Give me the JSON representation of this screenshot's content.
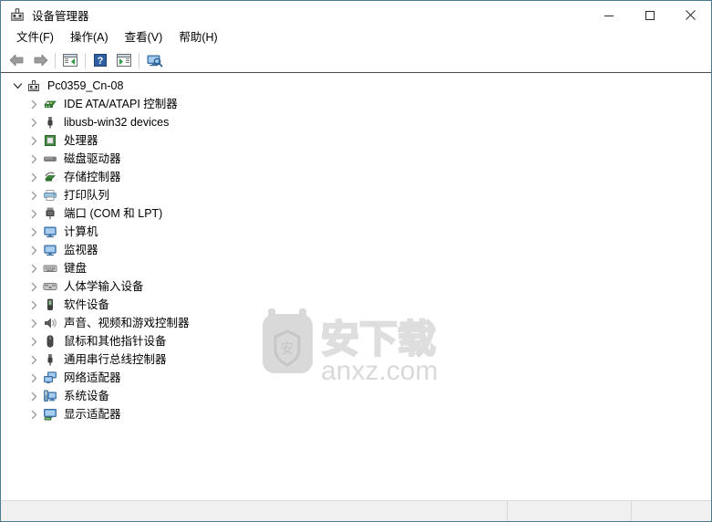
{
  "window": {
    "title": "设备管理器",
    "icon": "device-manager-icon",
    "controls": {
      "minimize": "最小化",
      "maximize": "最大化",
      "close": "关闭"
    },
    "border_color": "#4a7a8c"
  },
  "menubar": {
    "items": [
      {
        "label": "文件(F)",
        "name": "menu-file"
      },
      {
        "label": "操作(A)",
        "name": "menu-action"
      },
      {
        "label": "查看(V)",
        "name": "menu-view"
      },
      {
        "label": "帮助(H)",
        "name": "menu-help"
      }
    ]
  },
  "toolbar": {
    "items": [
      {
        "name": "back-button",
        "icon": "arrow-left-icon",
        "label": "后退"
      },
      {
        "name": "forward-button",
        "icon": "arrow-right-icon",
        "label": "前进"
      },
      {
        "name": "toolbar-separator-1",
        "icon": "separator",
        "label": ""
      },
      {
        "name": "show-hide-console-tree-button",
        "icon": "console-tree-icon",
        "label": "显示/隐藏控制台树"
      },
      {
        "name": "toolbar-separator-2",
        "icon": "separator",
        "label": ""
      },
      {
        "name": "help-button",
        "icon": "help-question-icon",
        "label": "帮助"
      },
      {
        "name": "properties-button",
        "icon": "properties-icon",
        "label": "属性"
      },
      {
        "name": "toolbar-separator-3",
        "icon": "separator",
        "label": ""
      },
      {
        "name": "scan-hardware-changes-button",
        "icon": "scan-monitor-icon",
        "label": "扫描检测硬件改动"
      }
    ]
  },
  "tree": {
    "root": {
      "label": "Pc0359_Cn-08",
      "icon": "computer-icon",
      "expanded": true
    },
    "children": [
      {
        "label": "IDE ATA/ATAPI 控制器",
        "icon": "ide-controller-icon"
      },
      {
        "label": "libusb-win32 devices",
        "icon": "usb-plug-icon"
      },
      {
        "label": "处理器",
        "icon": "processor-icon"
      },
      {
        "label": "磁盘驱动器",
        "icon": "disk-drive-icon"
      },
      {
        "label": "存储控制器",
        "icon": "storage-controller-icon"
      },
      {
        "label": "打印队列",
        "icon": "printer-icon"
      },
      {
        "label": "端口 (COM 和 LPT)",
        "icon": "port-icon"
      },
      {
        "label": "计算机",
        "icon": "monitor-icon"
      },
      {
        "label": "监视器",
        "icon": "monitor-icon"
      },
      {
        "label": "键盘",
        "icon": "keyboard-icon"
      },
      {
        "label": "人体学输入设备",
        "icon": "hid-icon"
      },
      {
        "label": "软件设备",
        "icon": "software-device-icon"
      },
      {
        "label": "声音、视频和游戏控制器",
        "icon": "speaker-icon"
      },
      {
        "label": "鼠标和其他指针设备",
        "icon": "mouse-icon"
      },
      {
        "label": "通用串行总线控制器",
        "icon": "usb-plug-icon"
      },
      {
        "label": "网络适配器",
        "icon": "network-adapter-icon"
      },
      {
        "label": "系统设备",
        "icon": "system-device-icon"
      },
      {
        "label": "显示适配器",
        "icon": "display-adapter-icon"
      }
    ]
  },
  "watermark": {
    "text_cn": "安下载",
    "text_en": "anxz.com",
    "badge_char": "安",
    "color": "#d9d9d9"
  },
  "statusbar": {
    "panes": [
      "",
      "",
      ""
    ]
  }
}
